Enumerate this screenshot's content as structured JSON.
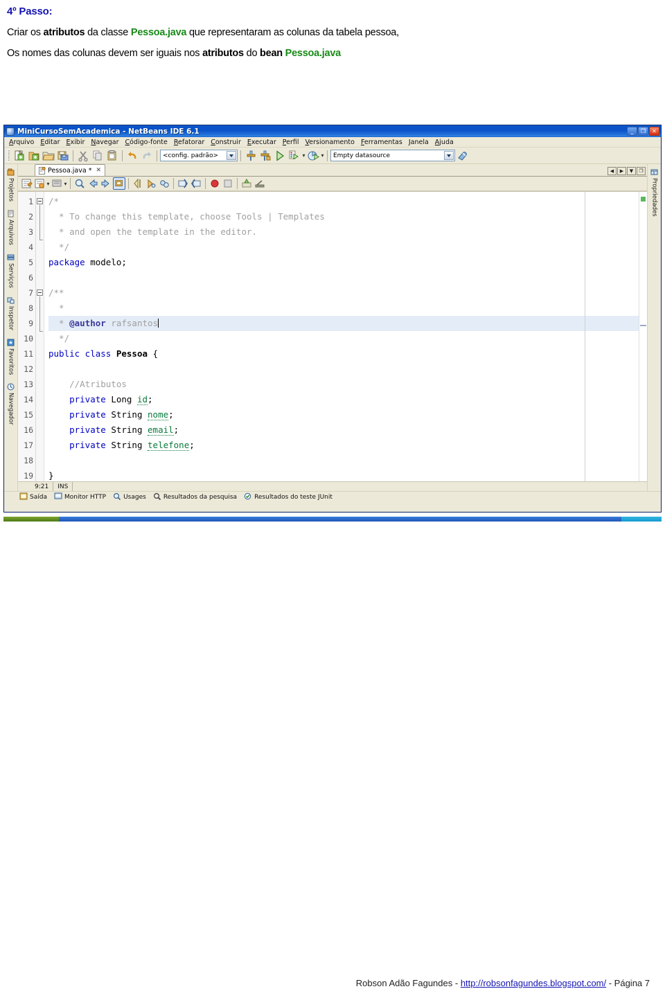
{
  "document": {
    "title": "4º Passo:",
    "paragraph1": {
      "seg1": "Criar os ",
      "seg2_bold": "atributos",
      "seg3": " da classe ",
      "seg4_green": "Pessoa.java",
      "seg5": " que representaram as colunas da tabela pessoa,"
    },
    "paragraph2": {
      "seg1": "Os nomes das colunas devem ser iguais nos ",
      "seg2_bold": "atributos",
      "seg3": " do ",
      "seg4_bold": "bean",
      "seg5_green": " Pessoa.java"
    },
    "colors": {
      "heading": "#1414b4",
      "green": "#1a8a1a",
      "link": "#1414b4"
    }
  },
  "footer": {
    "author": "Robson Adão Fagundes - ",
    "link": "http://robsonfagundes.blogspot.com/",
    "page": " - Página 7"
  },
  "netbeans": {
    "titlebar": {
      "title": "MiniCursoSemAcademica - NetBeans IDE 6.1",
      "minimize": "_",
      "restore": "❐",
      "close": "✕"
    },
    "menus": [
      "Arquivo",
      "Editar",
      "Exibir",
      "Navegar",
      "Código-fonte",
      "Refatorar",
      "Construir",
      "Executar",
      "Perfil",
      "Versionamento",
      "Ferramentas",
      "Janela",
      "Ajuda"
    ],
    "toolbar": {
      "buttons": [
        "new-file-icon",
        "new-project-icon",
        "open-project-icon",
        "save-all-icon",
        "cut-icon",
        "copy-icon",
        "paste-icon",
        "undo-icon",
        "redo-icon"
      ],
      "config_combo": "<config. padrão>",
      "buttons2": [
        "build-icon",
        "clean-build-icon",
        "run-icon",
        "debug-icon",
        "profile-icon"
      ],
      "datasource_combo": "Empty datasource",
      "datasource_button": "connect-icon"
    },
    "left_tabs": [
      {
        "label": "Projetos",
        "icon": "projects-icon"
      },
      {
        "label": "Arquivos",
        "icon": "files-icon"
      },
      {
        "label": "Serviços",
        "icon": "services-icon"
      },
      {
        "label": "Inspetor",
        "icon": "inspector-icon"
      },
      {
        "label": "Favoritos",
        "icon": "favorites-icon"
      },
      {
        "label": "Navegador",
        "icon": "navigator-icon"
      }
    ],
    "right_tabs": [
      {
        "label": "Propriedades",
        "icon": "properties-icon"
      }
    ],
    "document_tab": {
      "label": "Pessoa.java *",
      "close": "✕",
      "icon": "java-file-icon"
    },
    "tabrow_buttons": [
      "scroll-left-icon",
      "scroll-right-icon",
      "tab-list-icon",
      "maximize-icon"
    ],
    "editor_toolbar": [
      "last-edit-icon",
      "toggle-bookmark-icon",
      "comment-icon",
      "find-selection-icon",
      "previous-bookmark-icon",
      "next-bookmark-icon",
      "toggle-highlight-icon",
      "shift-left-icon",
      "shift-right-icon",
      "start-macro-icon",
      "stop-macro-icon",
      "toggle-breakpoint-icon",
      "next-error-icon",
      "inspect-icon",
      "run-to-cursor-icon"
    ],
    "status": {
      "position": "9:21",
      "insert_mode": "INS"
    },
    "bottom_tabs": [
      {
        "label": "Saída",
        "icon": "output-icon"
      },
      {
        "label": "Monitor HTTP",
        "icon": "http-monitor-icon"
      },
      {
        "label": "Usages",
        "icon": "usages-icon"
      },
      {
        "label": "Resultados da pesquisa",
        "icon": "search-results-icon"
      },
      {
        "label": "Resultados do teste JUnit",
        "icon": "junit-results-icon"
      }
    ],
    "code": {
      "lines": [
        {
          "n": "1",
          "tokens": [
            {
              "t": "/*",
              "c": "cmt"
            }
          ]
        },
        {
          "n": "2",
          "tokens": [
            {
              "t": "  * To change this template, choose Tools | Templates",
              "c": "cmt"
            }
          ]
        },
        {
          "n": "3",
          "tokens": [
            {
              "t": "  * and open the template in the editor.",
              "c": "cmt"
            }
          ]
        },
        {
          "n": "4",
          "tokens": [
            {
              "t": "  */",
              "c": "cmt"
            }
          ]
        },
        {
          "n": "5",
          "tokens": [
            {
              "t": "package",
              "c": "kw"
            },
            {
              "t": " modelo;",
              "c": ""
            }
          ]
        },
        {
          "n": "6",
          "tokens": [
            {
              "t": "",
              "c": ""
            }
          ]
        },
        {
          "n": "7",
          "tokens": [
            {
              "t": "/**",
              "c": "jd"
            }
          ]
        },
        {
          "n": "8",
          "tokens": [
            {
              "t": "  *",
              "c": "jd"
            }
          ]
        },
        {
          "n": "9",
          "tokens": [
            {
              "t": "  * ",
              "c": "jd"
            },
            {
              "t": "@author",
              "c": "jdt"
            },
            {
              "t": " rafsantos",
              "c": "jd"
            }
          ],
          "highlight": true,
          "caret": true
        },
        {
          "n": "10",
          "tokens": [
            {
              "t": "  */",
              "c": "jd"
            }
          ]
        },
        {
          "n": "11",
          "tokens": [
            {
              "t": "public class",
              "c": "kw"
            },
            {
              "t": " ",
              "c": ""
            },
            {
              "t": "Pessoa",
              "c": "cname"
            },
            {
              "t": " {",
              "c": ""
            }
          ]
        },
        {
          "n": "12",
          "tokens": [
            {
              "t": "",
              "c": ""
            }
          ]
        },
        {
          "n": "13",
          "tokens": [
            {
              "t": "    //Atributos",
              "c": "cmt"
            }
          ]
        },
        {
          "n": "14",
          "tokens": [
            {
              "t": "    ",
              "c": ""
            },
            {
              "t": "private",
              "c": "kw"
            },
            {
              "t": " Long ",
              "c": ""
            },
            {
              "t": "id",
              "c": "fld"
            },
            {
              "t": ";",
              "c": ""
            }
          ]
        },
        {
          "n": "15",
          "tokens": [
            {
              "t": "    ",
              "c": ""
            },
            {
              "t": "private",
              "c": "kw"
            },
            {
              "t": " String ",
              "c": ""
            },
            {
              "t": "nome",
              "c": "fld"
            },
            {
              "t": ";",
              "c": ""
            }
          ]
        },
        {
          "n": "16",
          "tokens": [
            {
              "t": "    ",
              "c": ""
            },
            {
              "t": "private",
              "c": "kw"
            },
            {
              "t": " String ",
              "c": ""
            },
            {
              "t": "email",
              "c": "fld"
            },
            {
              "t": ";",
              "c": ""
            }
          ]
        },
        {
          "n": "17",
          "tokens": [
            {
              "t": "    ",
              "c": ""
            },
            {
              "t": "private",
              "c": "kw"
            },
            {
              "t": " String ",
              "c": ""
            },
            {
              "t": "telefone",
              "c": "fld"
            },
            {
              "t": ";",
              "c": ""
            }
          ]
        },
        {
          "n": "18",
          "tokens": [
            {
              "t": "",
              "c": ""
            }
          ]
        },
        {
          "n": "19",
          "tokens": [
            {
              "t": "}",
              "c": ""
            }
          ]
        }
      ]
    }
  }
}
